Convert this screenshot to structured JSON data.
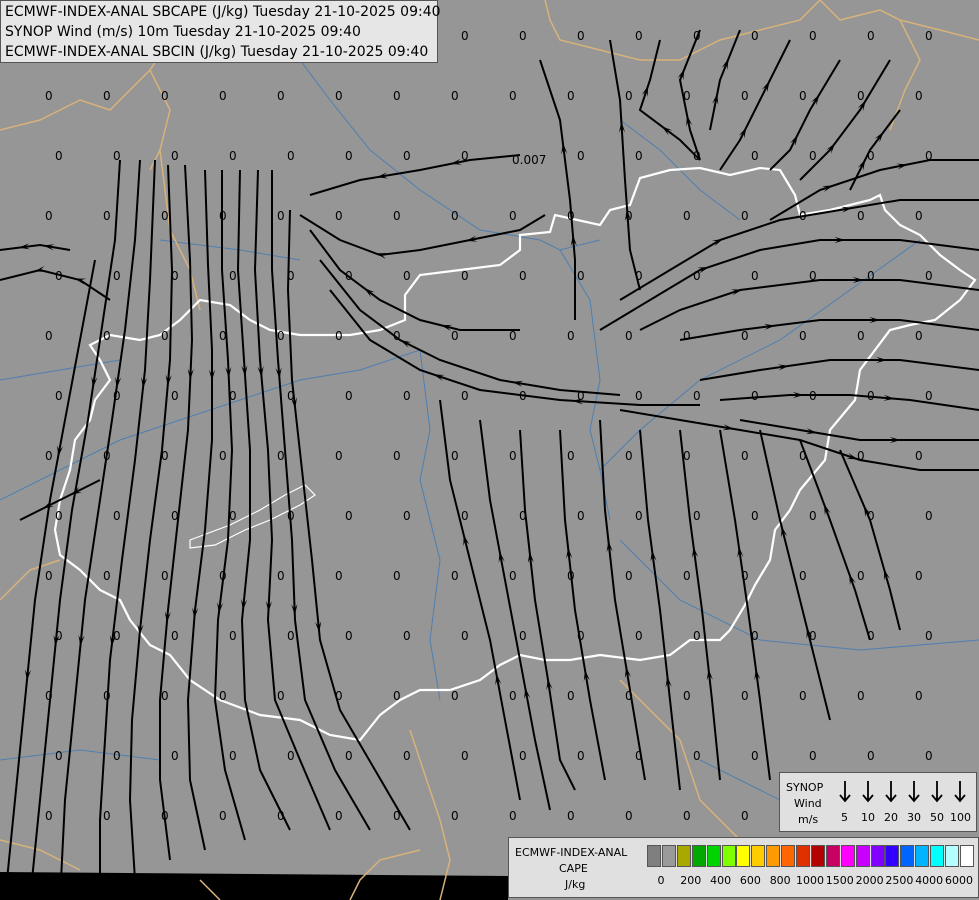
{
  "titles": [
    "ECMWF-INDEX-ANAL SBCAPE (J/kg) Tuesday 21-10-2025 09:40",
    "SYNOP Wind (m/s) 10m Tuesday 21-10-2025 09:40",
    "ECMWF-INDEX-ANAL SBCIN (J/kg) Tuesday 21-10-2025 09:40"
  ],
  "colors": {
    "background": "#969696",
    "streamline": "#000000",
    "hungary_border": "#ffffff",
    "country_border": "#d8b27a",
    "river": "#4f7fb0"
  },
  "grid_value_label": "0",
  "special_value_label": "0.007",
  "synop_legend": {
    "title_lines": [
      "SYNOP",
      "Wind",
      "m/s"
    ],
    "speeds": [
      "5",
      "10",
      "20",
      "30",
      "50",
      "100"
    ]
  },
  "cape_legend": {
    "title_lines": [
      "ECMWF-INDEX-ANAL",
      "CAPE",
      "J/kg"
    ],
    "swatches": [
      "#7f7f7f",
      "#9a9a9a",
      "#a8a800",
      "#00a800",
      "#00d400",
      "#7fff00",
      "#ffff00",
      "#ffcc00",
      "#ff9900",
      "#ff6600",
      "#e03000",
      "#b40000",
      "#c80064",
      "#ff00ff",
      "#c800ff",
      "#8200ff",
      "#3200ff",
      "#0064ff",
      "#00b4ff",
      "#00ffff",
      "#b4ffff",
      "#ffffff"
    ],
    "ticks": [
      "0",
      "200",
      "400",
      "600",
      "800",
      "1000",
      "1500",
      "2000",
      "2500",
      "4000",
      "6000"
    ]
  }
}
